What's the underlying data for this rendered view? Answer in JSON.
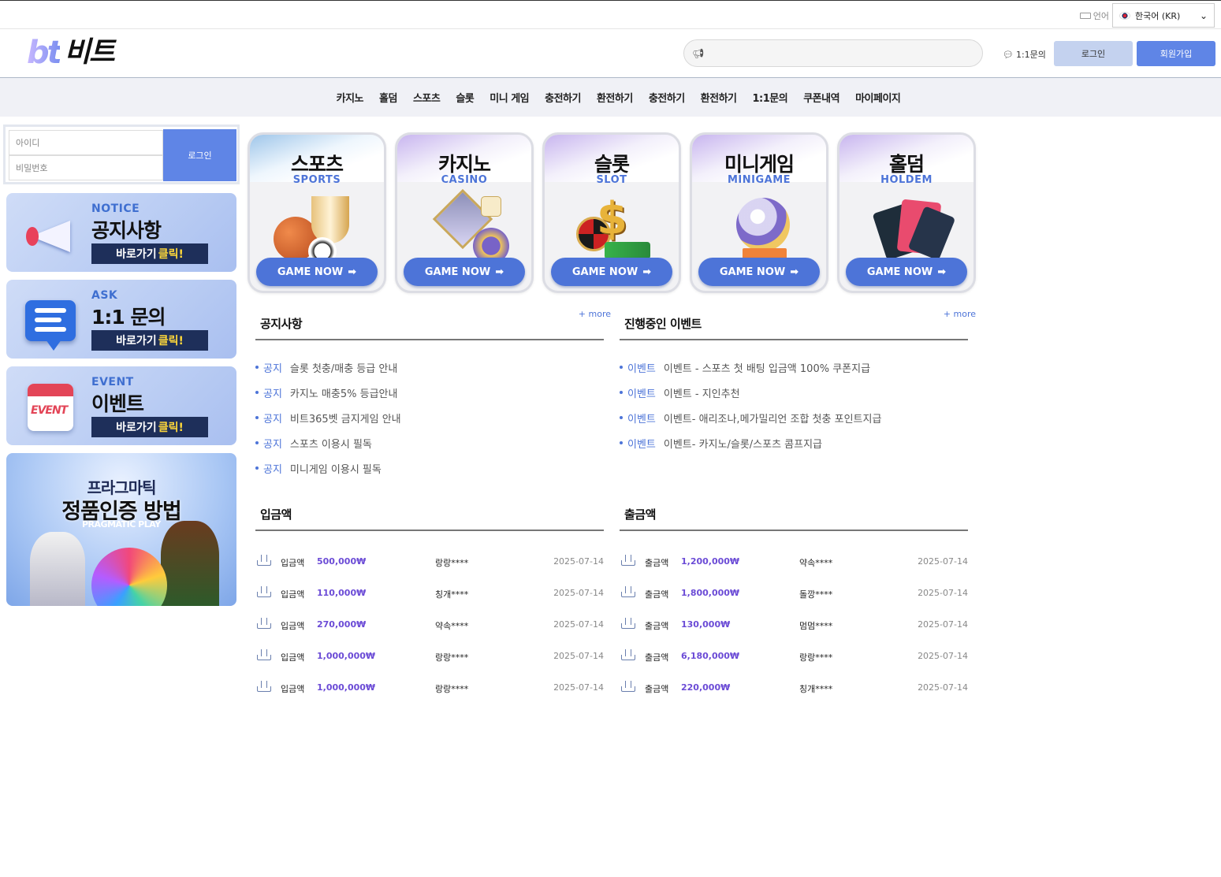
{
  "langbar": {
    "lang_label": "언어",
    "selected_language": "한국어 (KR)"
  },
  "header": {
    "logo_en": "bt",
    "logo_kr": "비트",
    "inquiry_link": "1:1문의",
    "login_button": "로그인",
    "join_button": "회원가입"
  },
  "nav": {
    "items": [
      "카지노",
      "홀덤",
      "스포츠",
      "슬롯",
      "미니 게임",
      "충전하기",
      "환전하기",
      "충전하기",
      "환전하기",
      "1:1문의",
      "쿠폰내역",
      "마이페이지"
    ]
  },
  "login_box": {
    "id_placeholder": "아이디",
    "pw_placeholder": "비밀번호",
    "login_button": "로그인"
  },
  "banners": {
    "notice": {
      "eng": "NOTICE",
      "kor": "공지사항",
      "go": "바로가기",
      "go_hl": "클릭!"
    },
    "ask": {
      "eng": "ASK",
      "kor": "1:1 문의",
      "go": "바로가기",
      "go_hl": "클릭!"
    },
    "event": {
      "eng": "EVENT",
      "kor": "이벤트",
      "go": "바로가기",
      "go_hl": "클릭!",
      "art_text": "EVENT"
    },
    "pragmatic": {
      "line1": "프라그마틱",
      "line2": "정품인증 방법",
      "brand": "PRAGMATIC PLAY"
    }
  },
  "game_cards": [
    {
      "kor": "스포츠",
      "eng": "SPORTS",
      "button": "GAME NOW"
    },
    {
      "kor": "카지노",
      "eng": "CASINO",
      "button": "GAME NOW"
    },
    {
      "kor": "슬롯",
      "eng": "SLOT",
      "button": "GAME NOW"
    },
    {
      "kor": "미니게임",
      "eng": "MINIGAME",
      "button": "GAME NOW"
    },
    {
      "kor": "홀덤",
      "eng": "HOLDEM",
      "button": "GAME NOW"
    }
  ],
  "notice_board": {
    "title": "공지사항",
    "more": "+ more",
    "items": [
      {
        "cat": "공지",
        "text": "슬롯 첫충/매충 등급 안내"
      },
      {
        "cat": "공지",
        "text": "카지노 매충5% 등급안내"
      },
      {
        "cat": "공지",
        "text": "비트365벳 금지게임 안내"
      },
      {
        "cat": "공지",
        "text": "스포츠 이용시 필독"
      },
      {
        "cat": "공지",
        "text": "미니게임 이용시 필독"
      }
    ]
  },
  "event_board": {
    "title": "진행중인 이벤트",
    "more": "+ more",
    "items": [
      {
        "cat": "이벤트",
        "text": "이벤트 - 스포츠 첫 배팅 입금액 100% 쿠폰지급"
      },
      {
        "cat": "이벤트",
        "text": "이벤트 - 지인추천"
      },
      {
        "cat": "이벤트",
        "text": "이벤트- 애리조나,메가밀리언 조합 첫충 포인트지급"
      },
      {
        "cat": "이벤트",
        "text": "이벤트- 카지노/슬롯/스포츠 콤프지급"
      }
    ]
  },
  "deposits": {
    "title": "입금액",
    "rows": [
      {
        "label": "입금액",
        "amount": "500,000₩",
        "user": "랑랑****",
        "date": "2025-07-14"
      },
      {
        "label": "입금액",
        "amount": "110,000₩",
        "user": "칭개****",
        "date": "2025-07-14"
      },
      {
        "label": "입금액",
        "amount": "270,000₩",
        "user": "약속****",
        "date": "2025-07-14"
      },
      {
        "label": "입금액",
        "amount": "1,000,000₩",
        "user": "랑랑****",
        "date": "2025-07-14"
      },
      {
        "label": "입금액",
        "amount": "1,000,000₩",
        "user": "랑랑****",
        "date": "2025-07-14"
      }
    ]
  },
  "withdrawals": {
    "title": "출금액",
    "rows": [
      {
        "label": "출금액",
        "amount": "1,200,000₩",
        "user": "약속****",
        "date": "2025-07-14"
      },
      {
        "label": "출금액",
        "amount": "1,800,000₩",
        "user": "돌깡****",
        "date": "2025-07-14"
      },
      {
        "label": "출금액",
        "amount": "130,000₩",
        "user": "멈멈****",
        "date": "2025-07-14"
      },
      {
        "label": "출금액",
        "amount": "6,180,000₩",
        "user": "랑랑****",
        "date": "2025-07-14"
      },
      {
        "label": "출금액",
        "amount": "220,000₩",
        "user": "칭개****",
        "date": "2025-07-14"
      }
    ]
  },
  "colors": {
    "accent": "#5f85e6",
    "accent_light": "#c4d2ef",
    "category_blue": "#4d74d8",
    "amount_purple": "#6b4bd6",
    "banner_dark": "#1e2f5a",
    "highlight_yellow": "#ffd83a"
  },
  "icons": {
    "announce": "megaphone-icon",
    "chat": "chat-bubble-icon",
    "download": "download-tray-icon",
    "arrow": "arrow-right-icon",
    "chevron": "chevron-down-icon"
  }
}
